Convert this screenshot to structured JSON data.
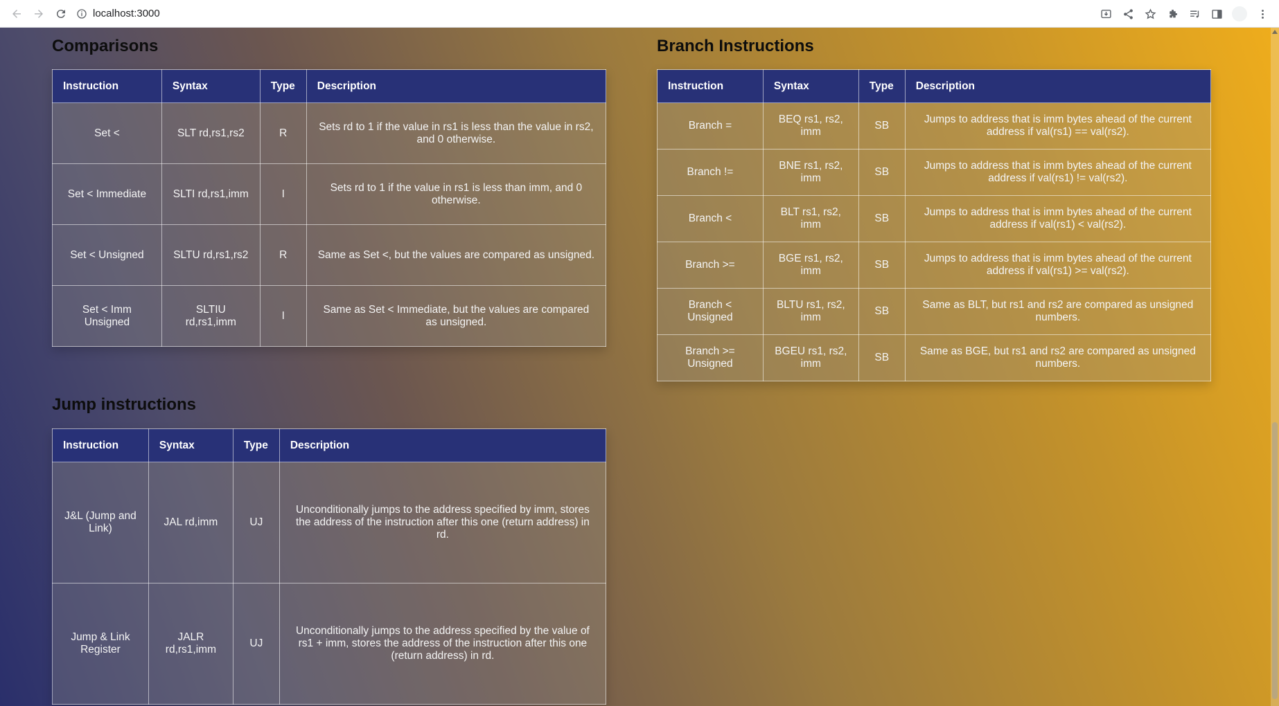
{
  "browser": {
    "url": "localhost:3000"
  },
  "comparisons": {
    "title": "Comparisons",
    "headers": [
      "Instruction",
      "Syntax",
      "Type",
      "Description"
    ],
    "rows": [
      {
        "instruction": "Set <",
        "syntax": "SLT rd,rs1,rs2",
        "type": "R",
        "description": "Sets rd to 1 if the value in rs1 is less than the value in rs2, and 0 otherwise."
      },
      {
        "instruction": "Set < Immediate",
        "syntax": "SLTI rd,rs1,imm",
        "type": "I",
        "description": "Sets rd to 1 if the value in rs1 is less than imm, and 0 otherwise."
      },
      {
        "instruction": "Set < Unsigned",
        "syntax": "SLTU rd,rs1,rs2",
        "type": "R",
        "description": "Same as Set <, but the values are compared as unsigned."
      },
      {
        "instruction": "Set < Imm Unsigned",
        "syntax": "SLTIU rd,rs1,imm",
        "type": "I",
        "description": "Same as Set < Immediate, but the values are compared as unsigned."
      }
    ]
  },
  "branch": {
    "title": "Branch Instructions",
    "headers": [
      "Instruction",
      "Syntax",
      "Type",
      "Description"
    ],
    "rows": [
      {
        "instruction": "Branch =",
        "syntax": "BEQ rs1, rs2, imm",
        "type": "SB",
        "description": "Jumps to address that is imm bytes ahead of the current address if val(rs1) == val(rs2)."
      },
      {
        "instruction": "Branch !=",
        "syntax": "BNE rs1, rs2, imm",
        "type": "SB",
        "description": "Jumps to address that is imm bytes ahead of the current address if val(rs1) != val(rs2)."
      },
      {
        "instruction": "Branch <",
        "syntax": "BLT rs1, rs2, imm",
        "type": "SB",
        "description": "Jumps to address that is imm bytes ahead of the current address if val(rs1) < val(rs2)."
      },
      {
        "instruction": "Branch >=",
        "syntax": "BGE rs1, rs2, imm",
        "type": "SB",
        "description": "Jumps to address that is imm bytes ahead of the current address if val(rs1) >= val(rs2)."
      },
      {
        "instruction": "Branch < Unsigned",
        "syntax": "BLTU rs1, rs2, imm",
        "type": "SB",
        "description": "Same as BLT, but rs1 and rs2 are compared as unsigned numbers."
      },
      {
        "instruction": "Branch >= Unsigned",
        "syntax": "BGEU rs1, rs2, imm",
        "type": "SB",
        "description": "Same as BGE, but rs1 and rs2 are compared as unsigned numbers."
      }
    ]
  },
  "jump": {
    "title": "Jump instructions",
    "headers": [
      "Instruction",
      "Syntax",
      "Type",
      "Description"
    ],
    "rows": [
      {
        "instruction": "J&L (Jump and Link)",
        "syntax": "JAL rd,imm",
        "type": "UJ",
        "description": "Unconditionally jumps to the address specified by imm, stores the address of the instruction after this one (return address) in rd."
      },
      {
        "instruction": "Jump & Link Register",
        "syntax": "JALR rd,rs1,imm",
        "type": "UJ",
        "description": "Unconditionally jumps to the address specified by the value of rs1 + imm, stores the address of the instruction after this one (return address) in rd."
      }
    ]
  }
}
